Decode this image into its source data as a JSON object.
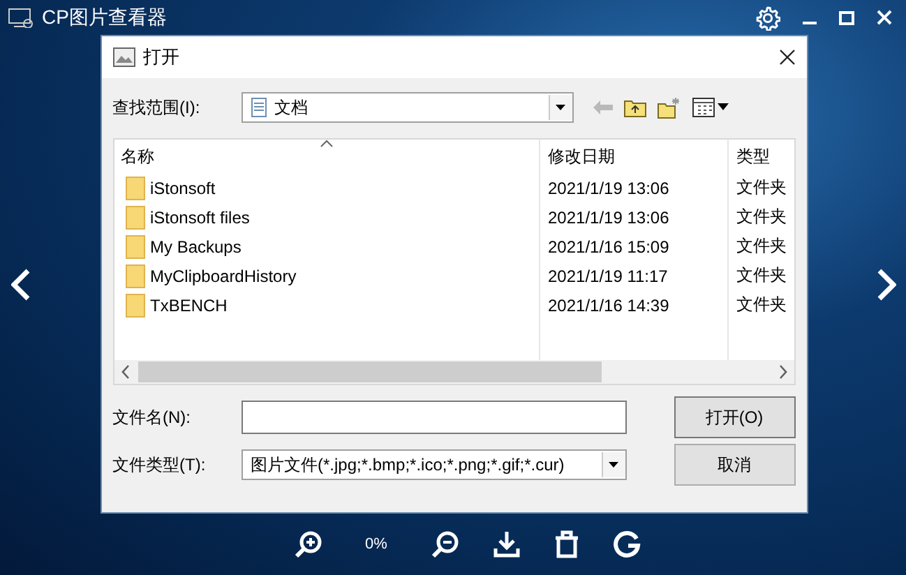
{
  "app": {
    "title": "CP图片查看器"
  },
  "dialog": {
    "title": "打开",
    "look_in": {
      "label": "查找范围(I):",
      "value": "文档"
    },
    "file_list": {
      "columns": [
        {
          "label": "名称",
          "sorted": true
        },
        {
          "label": "修改日期",
          "sorted": false
        },
        {
          "label": "类型",
          "sorted": false
        }
      ],
      "rows": [
        {
          "name": "iStonsoft",
          "modified": "2021/1/19 13:06",
          "type": "文件夹"
        },
        {
          "name": "iStonsoft files",
          "modified": "2021/1/19 13:06",
          "type": "文件夹"
        },
        {
          "name": "My Backups",
          "modified": "2021/1/16 15:09",
          "type": "文件夹"
        },
        {
          "name": "MyClipboardHistory",
          "modified": "2021/1/19 11:17",
          "type": "文件夹"
        },
        {
          "name": "TxBENCH",
          "modified": "2021/1/16 14:39",
          "type": "文件夹"
        }
      ]
    },
    "file_name": {
      "label": "文件名(N):"
    },
    "file_type": {
      "label": "文件类型(T):",
      "value": "图片文件(*.jpg;*.bmp;*.ico;*.png;*.gif;*.cur)"
    },
    "buttons": [
      {
        "label": "打开(O)",
        "kind": "primary"
      },
      {
        "label": "取消",
        "kind": "cancel"
      }
    ]
  },
  "toolbar": {
    "zoom": "0%"
  }
}
